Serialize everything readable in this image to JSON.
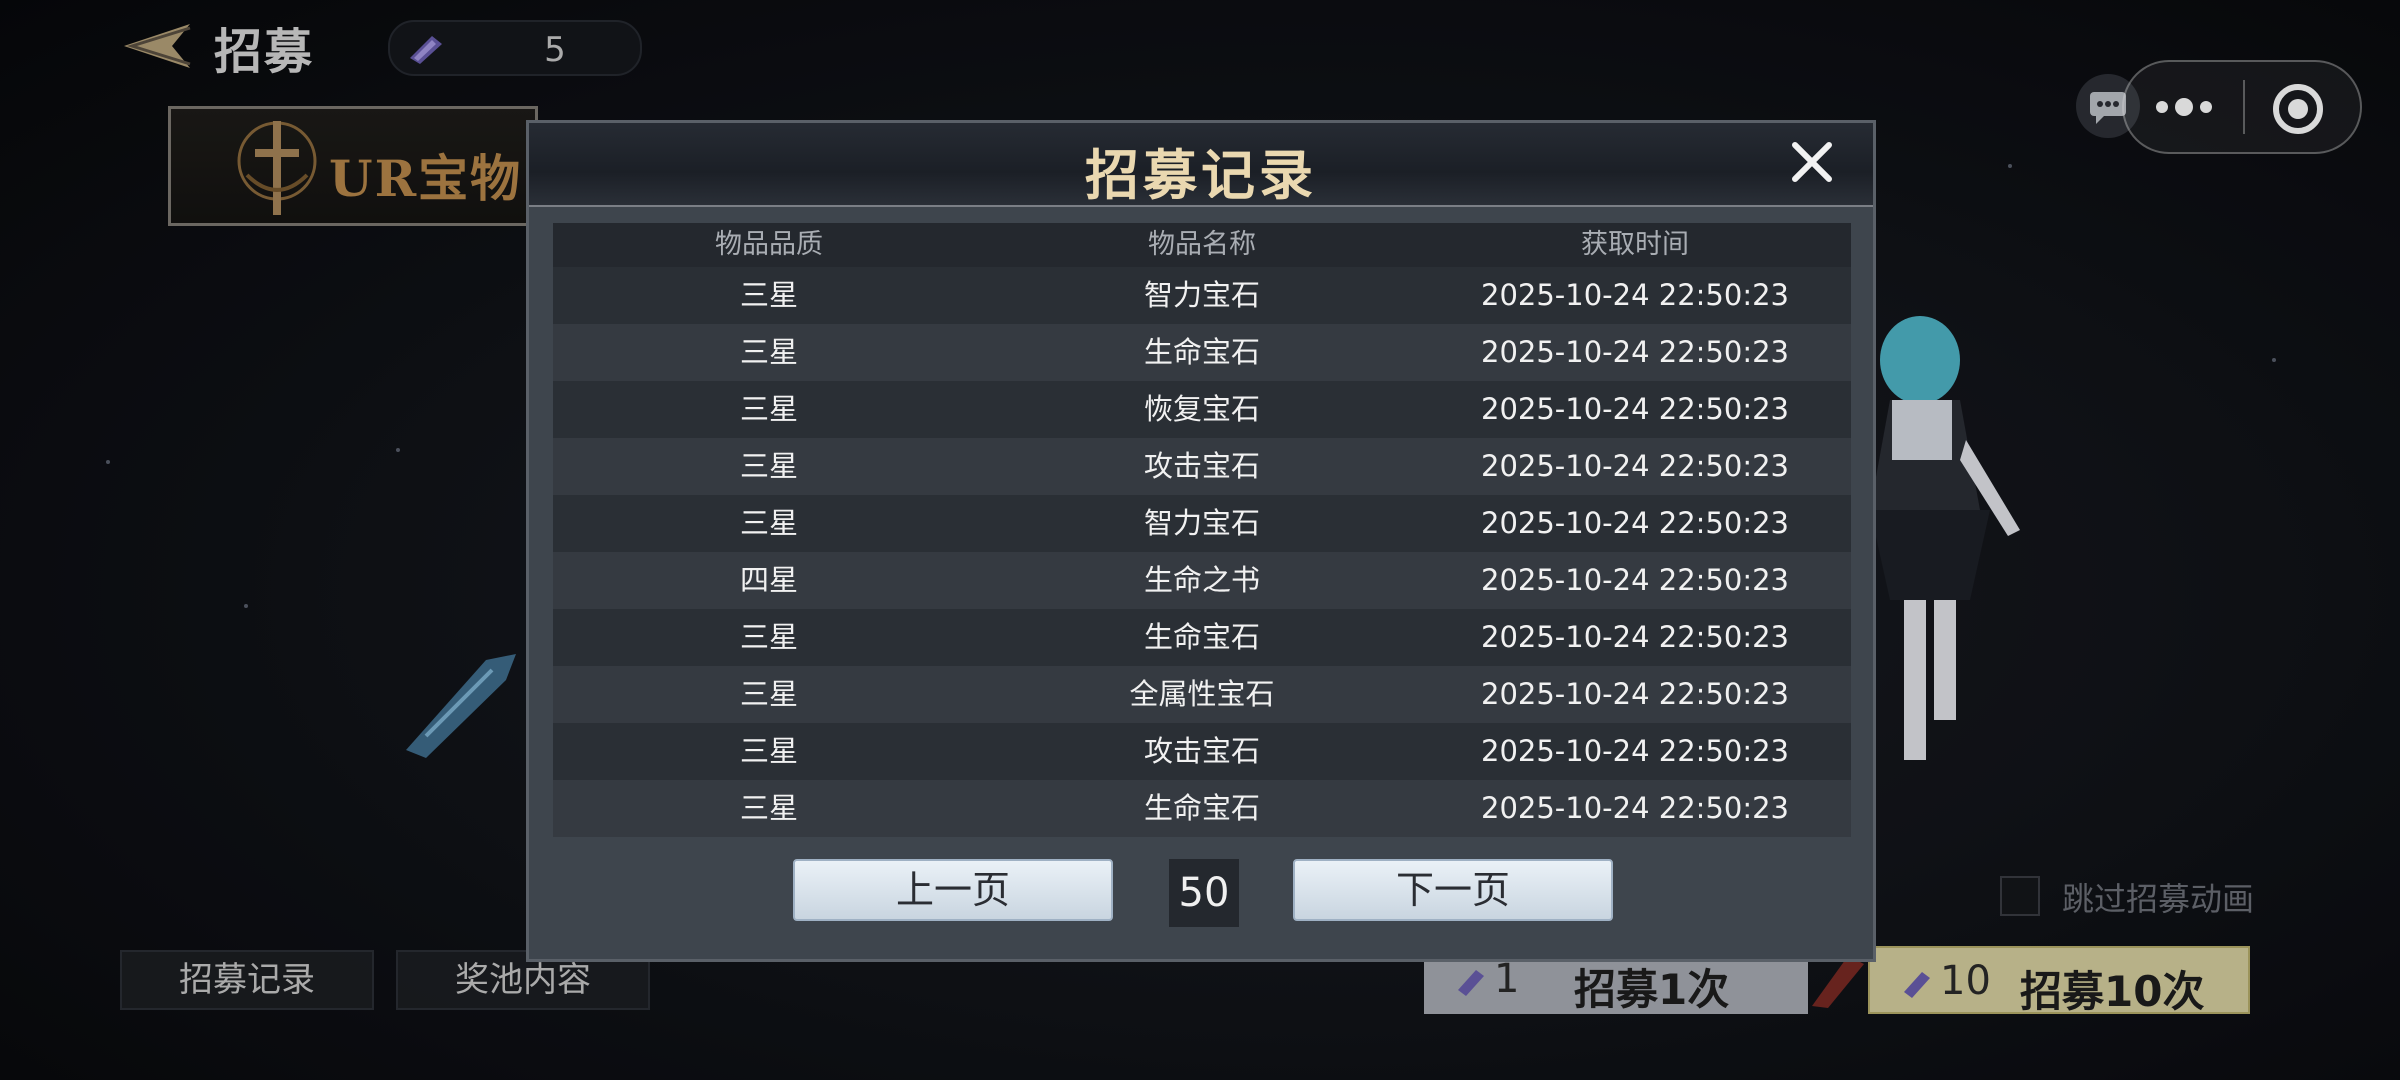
{
  "header": {
    "title": "招募",
    "currency_value": "5"
  },
  "ur_tab": {
    "label": "UR宝物"
  },
  "bottom": {
    "record_btn": "招募记录",
    "pool_btn": "奖池内容",
    "skip_label": "跳过招募动画",
    "draw1_count": "1",
    "draw1_label": "招募1次",
    "draw10_count": "10",
    "draw10_label": "招募10次"
  },
  "modal": {
    "title": "招募记录",
    "columns": [
      "物品品质",
      "物品名称",
      "获取时间"
    ],
    "rows": [
      {
        "quality": "三星",
        "name": "智力宝石",
        "time": "2025-10-24 22:50:23"
      },
      {
        "quality": "三星",
        "name": "生命宝石",
        "time": "2025-10-24 22:50:23"
      },
      {
        "quality": "三星",
        "name": "恢复宝石",
        "time": "2025-10-24 22:50:23"
      },
      {
        "quality": "三星",
        "name": "攻击宝石",
        "time": "2025-10-24 22:50:23"
      },
      {
        "quality": "三星",
        "name": "智力宝石",
        "time": "2025-10-24 22:50:23"
      },
      {
        "quality": "四星",
        "name": "生命之书",
        "time": "2025-10-24 22:50:23"
      },
      {
        "quality": "三星",
        "name": "生命宝石",
        "time": "2025-10-24 22:50:23"
      },
      {
        "quality": "三星",
        "name": "全属性宝石",
        "time": "2025-10-24 22:50:23"
      },
      {
        "quality": "三星",
        "name": "攻击宝石",
        "time": "2025-10-24 22:50:23"
      },
      {
        "quality": "三星",
        "name": "生命宝石",
        "time": "2025-10-24 22:50:23"
      }
    ],
    "prev_label": "上一页",
    "page_number": "50",
    "next_label": "下一页"
  },
  "icons": {
    "back": "back-arrow-icon",
    "currency": "crystal-icon",
    "close": "close-icon",
    "chat": "chat-icon",
    "more": "more-dots-icon",
    "target": "target-icon"
  },
  "colors": {
    "title_gold": "#ead8b0",
    "ur_gold": "#b8884a",
    "draw10_bg": "#d8d0a0",
    "draw1_bg": "#a9acb4",
    "pager_bg": "#dfe8f0"
  }
}
